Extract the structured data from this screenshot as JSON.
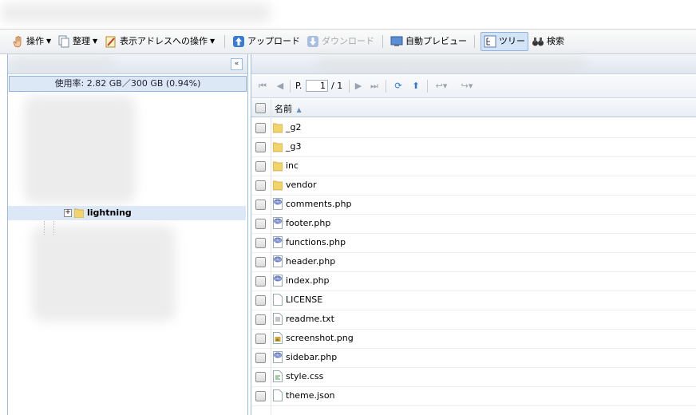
{
  "toolbar": {
    "operation": "操作",
    "organize": "整理",
    "address_ops": "表示アドレスへの操作",
    "upload": "アップロード",
    "download": "ダウンロード",
    "auto_preview": "自動プレビュー",
    "tree": "ツリー",
    "search": "検索"
  },
  "left_panel": {
    "collapse_label": "«",
    "usage": "使用率: 2.82 GB／300 GB (0.94%)",
    "tree_folder": "lightning",
    "expand_symbol": "+"
  },
  "pager": {
    "page_prefix": "P.",
    "page_value": "1",
    "page_total": "/ 1"
  },
  "grid": {
    "column_name": "名前",
    "sort_indicator": "▲",
    "files": [
      {
        "name": "_g2",
        "type": "folder"
      },
      {
        "name": "_g3",
        "type": "folder"
      },
      {
        "name": "inc",
        "type": "folder"
      },
      {
        "name": "vendor",
        "type": "folder"
      },
      {
        "name": "comments.php",
        "type": "php"
      },
      {
        "name": "footer.php",
        "type": "php"
      },
      {
        "name": "functions.php",
        "type": "php"
      },
      {
        "name": "header.php",
        "type": "php"
      },
      {
        "name": "index.php",
        "type": "php"
      },
      {
        "name": "LICENSE",
        "type": "blank"
      },
      {
        "name": "readme.txt",
        "type": "text"
      },
      {
        "name": "screenshot.png",
        "type": "image"
      },
      {
        "name": "sidebar.php",
        "type": "php"
      },
      {
        "name": "style.css",
        "type": "css"
      },
      {
        "name": "theme.json",
        "type": "blank"
      }
    ]
  },
  "colors": {
    "accent_blue": "#99bbe8",
    "selected_bg": "#dde8f6",
    "folder_yellow": "#f5d36b"
  }
}
